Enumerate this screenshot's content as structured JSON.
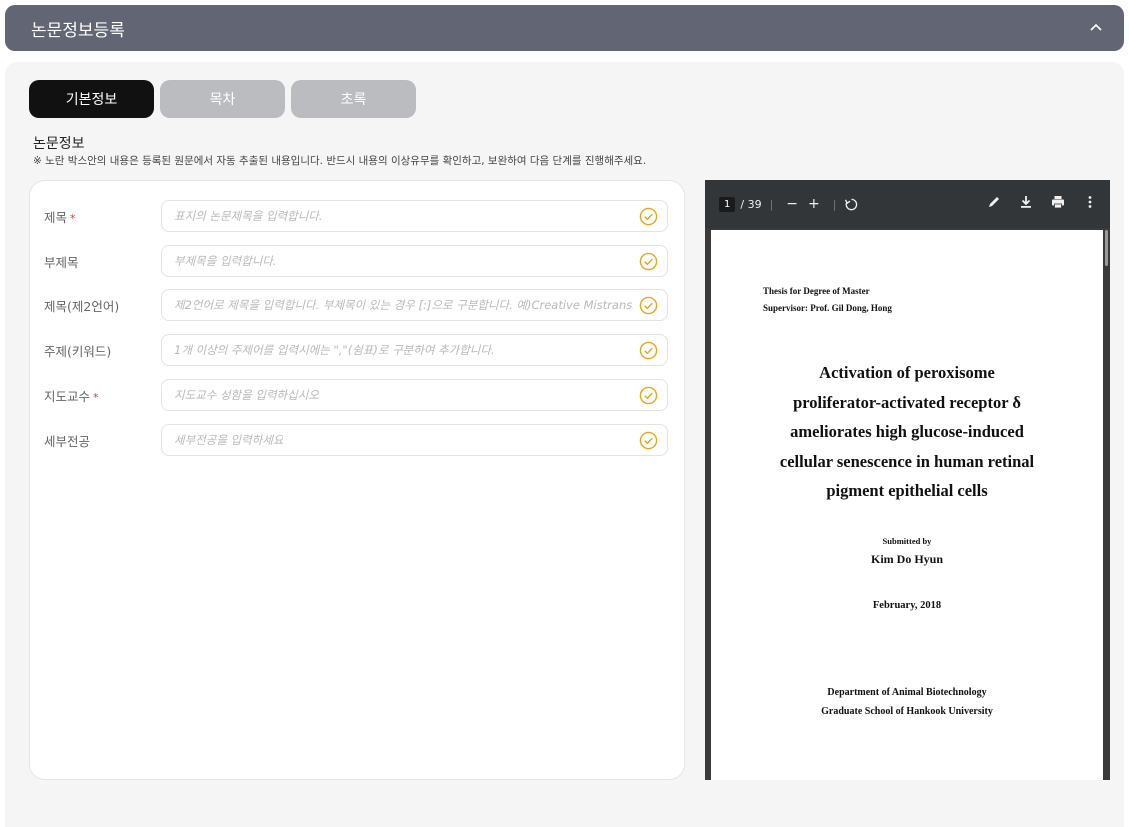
{
  "header": {
    "title": "논문정보등록",
    "collapse_icon": "chevron-up-icon"
  },
  "tabs": [
    {
      "label": "기본정보",
      "active": true
    },
    {
      "label": "목차",
      "active": false
    },
    {
      "label": "초록",
      "active": false
    }
  ],
  "section": {
    "title": "논문정보",
    "notice": "※ 노란 박스안의 내용은 등록된 원문에서 자동 추출된 내용입니다. 반드시 내용의 이상유무를 확인하고, 보완하여 다음 단계를 진행해주세요."
  },
  "form": {
    "required_mark": "*",
    "fields": [
      {
        "label": "제목",
        "required": true,
        "placeholder": "표지의 논문제목을 입력합니다."
      },
      {
        "label": "부제목",
        "required": false,
        "placeholder": "부제목을 입력합니다."
      },
      {
        "label": "제목(제2언어)",
        "required": false,
        "placeholder": "제2언어로 제목을 입력합니다. 부제목이 있는 경우 [:]으로 구분합니다. 예)Creative Mistranslat"
      },
      {
        "label": "주제(키워드)",
        "required": false,
        "placeholder": "1개 이상의 주제어를 입력시에는 \",\"(쉼표)로 구분하여 추가합니다."
      },
      {
        "label": "지도교수",
        "required": true,
        "placeholder": "지도교수 성함을 입력하십시오"
      },
      {
        "label": "세부전공",
        "required": false,
        "placeholder": "세부전공을 입력하세요"
      }
    ],
    "check_color": "#e3a81e"
  },
  "pdf": {
    "toolbar": {
      "page_current": "1",
      "page_total": "/ 39",
      "zoom_out": "−",
      "zoom_in": "+",
      "icons": [
        "rotate-icon",
        "pen-icon",
        "download-icon",
        "print-icon",
        "more-icon"
      ]
    },
    "page": {
      "meta_line1": "Thesis for Degree of Master",
      "meta_line2": "Supervisor: Prof. Gil Dong, Hong",
      "title_lines": [
        "Activation of peroxisome",
        "proliferator-activated receptor δ",
        "ameliorates high glucose-induced",
        "cellular senescence in human retinal",
        "pigment epithelial cells"
      ],
      "submitted_by": "Submitted by",
      "author": "Kim Do Hyun",
      "date": "February, 2018",
      "dept_line1": "Department of Animal Biotechnology",
      "dept_line2": "Graduate School of Hankook University"
    }
  }
}
